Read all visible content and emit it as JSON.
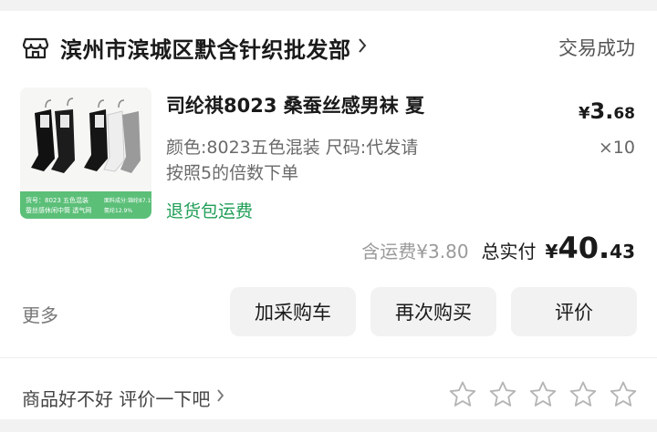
{
  "order": {
    "shop_name": "滨州市滨城区默含针织批发部",
    "status": "交易成功",
    "product": {
      "title": "司纶祺8023 桑蚕丝感男袜 夏",
      "sku_line1": "颜色:8023五色混装 尺码:代发请",
      "sku_line2": "按照5的倍数下单",
      "badge": "退货包运费",
      "price_symbol": "¥",
      "price_int": "3.",
      "price_dec": "68",
      "quantity": "×10",
      "thumb_caption_line1": "货号：8023 五色混装",
      "thumb_caption_line2": "蚕丝感休闲中筒 透气网",
      "thumb_caption_right1": "面料成分:锦纶87.1%",
      "thumb_caption_right2": "氨纶12.9%"
    },
    "shipping_label": "含运费",
    "shipping_value": "¥3.80",
    "paid_label": "总实付",
    "paid_symbol": "¥",
    "paid_int": "40.",
    "paid_dec": "43"
  },
  "actions": {
    "more": "更多",
    "add_to_cart": "加采购车",
    "buy_again": "再次购买",
    "review": "评价"
  },
  "rating": {
    "prompt": "商品好不好 评价一下吧",
    "stars": 5,
    "filled": 0
  },
  "colors": {
    "accent_green": "#1f9e57",
    "button_bg": "#f2f2f2"
  }
}
